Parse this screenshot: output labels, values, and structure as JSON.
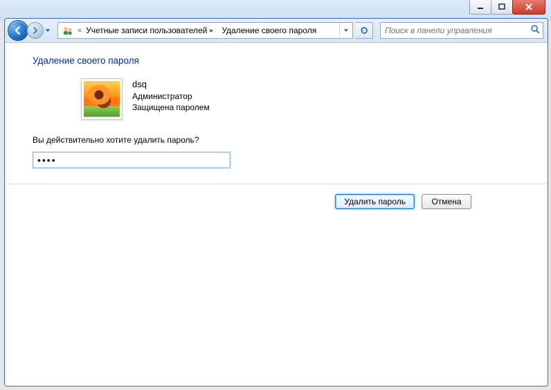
{
  "caption_buttons": {
    "minimize": "minimize",
    "maximize": "maximize",
    "close": "close"
  },
  "breadcrumb": {
    "prefix_glyph": "«",
    "segments": [
      "Учетные записи пользователей",
      "Удаление своего пароля"
    ]
  },
  "search": {
    "placeholder": "Поиск в панели управления"
  },
  "page": {
    "title": "Удаление своего пароля",
    "account": {
      "username": "dsq",
      "role": "Администратор",
      "protection": "Защищена паролем"
    },
    "prompt": "Вы действительно хотите удалить пароль?",
    "password_value": "••••"
  },
  "buttons": {
    "delete": "Удалить пароль",
    "cancel": "Отмена"
  }
}
